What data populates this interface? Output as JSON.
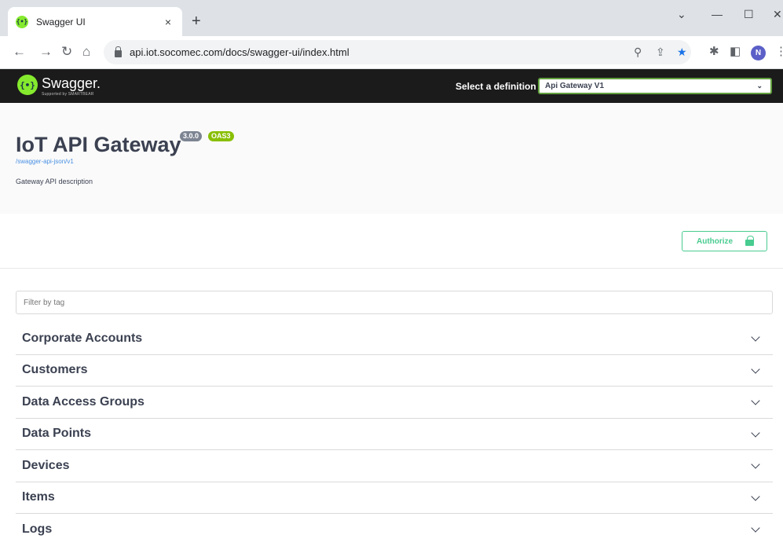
{
  "browser": {
    "tab_title": "Swagger UI",
    "tab_close": "×",
    "new_tab": "+",
    "url": "api.iot.socomec.com/docs/swagger-ui/index.html",
    "profile_initial": "N",
    "favicon_glyph": "{•}"
  },
  "topbar": {
    "logo_glyph": "{•}",
    "brand": "Swagger.",
    "tagline": "Supported by SMARTBEAR",
    "select_label": "Select a definition",
    "selected_definition": "Api Gateway V1"
  },
  "info": {
    "title": "IoT API Gateway",
    "version_badge": "3.0.0",
    "oas_badge": "OAS3",
    "spec_link": "/swagger-api-json/v1",
    "description": "Gateway API description"
  },
  "authorize": {
    "label": "Authorize"
  },
  "filter": {
    "placeholder": "Filter by tag"
  },
  "tags": [
    "Corporate Accounts",
    "Customers",
    "Data Access Groups",
    "Data Points",
    "Devices",
    "Items",
    "Logs"
  ],
  "colors": {
    "topbar_bg": "#1b1b1b",
    "swagger_green": "#85ea2d",
    "authorize_green": "#49cc90",
    "select_border": "#62a03f",
    "version_badge": "#7d8492",
    "oas_badge": "#89bf04",
    "link": "#4990e2"
  }
}
